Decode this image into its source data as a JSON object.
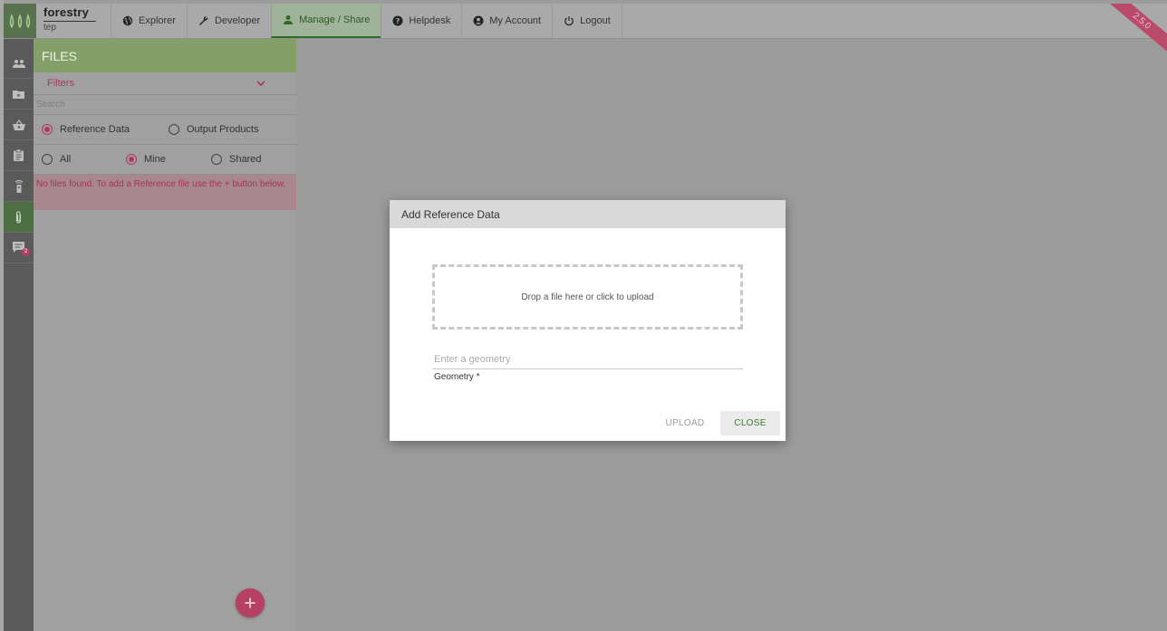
{
  "brand": {
    "name": "forestry",
    "sub": "tep"
  },
  "nav": [
    {
      "label": "Explorer",
      "icon": "globe-icon"
    },
    {
      "label": "Developer",
      "icon": "wrench-icon"
    },
    {
      "label": "Manage / Share",
      "icon": "user-icon",
      "active": true
    },
    {
      "label": "Helpdesk",
      "icon": "help-icon"
    },
    {
      "label": "My Account",
      "icon": "account-icon"
    },
    {
      "label": "Logout",
      "icon": "power-icon"
    }
  ],
  "version": "2.5.0",
  "sidebar_icons": [
    "group-icon",
    "folder-icon",
    "basket-icon",
    "clipboard-icon",
    "remote-icon",
    "paperclip-icon",
    "message-icon"
  ],
  "message_badge": "2",
  "files": {
    "title": "FILES",
    "filters_label": "Filters",
    "search_placeholder": "Search",
    "type_options": [
      {
        "label": "Reference Data",
        "selected": true
      },
      {
        "label": "Output Products",
        "selected": false
      }
    ],
    "owner_options": [
      {
        "label": "All",
        "selected": false
      },
      {
        "label": "Mine",
        "selected": true
      },
      {
        "label": "Shared",
        "selected": false
      }
    ],
    "notice": "No files found. To add a Reference file use the + button below."
  },
  "modal": {
    "title": "Add Reference Data",
    "dropzone_text": "Drop a file here or click to upload",
    "geometry_placeholder": "Enter a geometry",
    "geometry_label": "Geometry *",
    "upload_label": "UPLOAD",
    "close_label": "CLOSE"
  },
  "colors": {
    "accent_green": "#84a068",
    "active_nav": "#2e6b26",
    "pink": "#b13a5d"
  }
}
